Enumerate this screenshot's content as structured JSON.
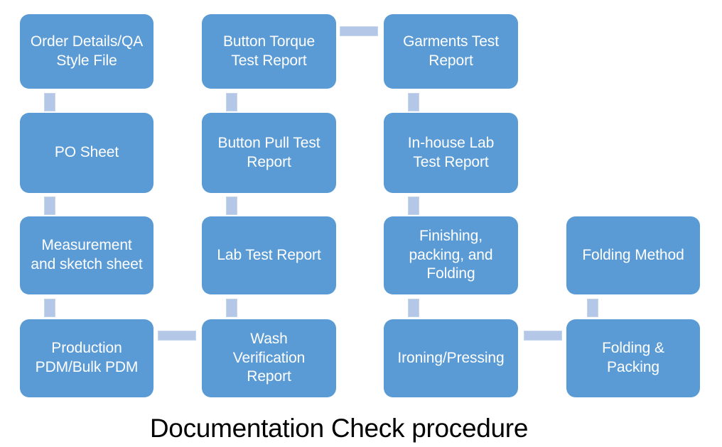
{
  "diagram": {
    "title": "Documentation Check procedure",
    "colors": {
      "node_fill": "#5B9BD5",
      "node_text": "#FFFFFF",
      "connector_fill": "#B4C7E7",
      "background": "#FFFFFF",
      "caption_text": "#000000"
    },
    "nodes": [
      {
        "id": "n1",
        "label": "Order Details/QA\nStyle File",
        "column": 1,
        "row": 1
      },
      {
        "id": "n2",
        "label": "PO Sheet",
        "column": 1,
        "row": 2
      },
      {
        "id": "n3",
        "label": "Measurement\nand sketch sheet",
        "column": 1,
        "row": 3
      },
      {
        "id": "n4",
        "label": "Production\nPDM/Bulk PDM",
        "column": 1,
        "row": 4
      },
      {
        "id": "n5",
        "label": "Button Torque\nTest Report",
        "column": 2,
        "row": 1
      },
      {
        "id": "n6",
        "label": "Button Pull Test\nReport",
        "column": 2,
        "row": 2
      },
      {
        "id": "n7",
        "label": "Lab Test Report",
        "column": 2,
        "row": 3
      },
      {
        "id": "n8",
        "label": "Wash\nVerification\nReport",
        "column": 2,
        "row": 4
      },
      {
        "id": "n9",
        "label": "Garments Test\nReport",
        "column": 3,
        "row": 1
      },
      {
        "id": "n10",
        "label": "In-house Lab\nTest Report",
        "column": 3,
        "row": 2
      },
      {
        "id": "n11",
        "label": "Finishing,\npacking, and\nFolding",
        "column": 3,
        "row": 3
      },
      {
        "id": "n12",
        "label": "Ironing/Pressing",
        "column": 3,
        "row": 4
      },
      {
        "id": "n13",
        "label": "Folding Method",
        "column": 4,
        "row": 3
      },
      {
        "id": "n14",
        "label": "Folding &\nPacking",
        "column": 4,
        "row": 4
      }
    ],
    "connectors": [
      {
        "id": "k1",
        "from": "n1",
        "to": "n2",
        "orientation": "vertical"
      },
      {
        "id": "k2",
        "from": "n2",
        "to": "n3",
        "orientation": "vertical"
      },
      {
        "id": "k3",
        "from": "n3",
        "to": "n4",
        "orientation": "vertical"
      },
      {
        "id": "k4",
        "from": "n4",
        "to": "n8",
        "orientation": "horizontal"
      },
      {
        "id": "k5",
        "from": "n5",
        "to": "n6",
        "orientation": "vertical"
      },
      {
        "id": "k6",
        "from": "n6",
        "to": "n7",
        "orientation": "vertical"
      },
      {
        "id": "k7",
        "from": "n7",
        "to": "n8",
        "orientation": "vertical"
      },
      {
        "id": "k8",
        "from": "n5",
        "to": "n9",
        "orientation": "horizontal"
      },
      {
        "id": "k9",
        "from": "n9",
        "to": "n10",
        "orientation": "vertical"
      },
      {
        "id": "k10",
        "from": "n10",
        "to": "n11",
        "orientation": "vertical"
      },
      {
        "id": "k11",
        "from": "n11",
        "to": "n12",
        "orientation": "vertical"
      },
      {
        "id": "k12",
        "from": "n12",
        "to": "n14",
        "orientation": "horizontal"
      },
      {
        "id": "k13",
        "from": "n13",
        "to": "n14",
        "orientation": "vertical"
      }
    ]
  }
}
